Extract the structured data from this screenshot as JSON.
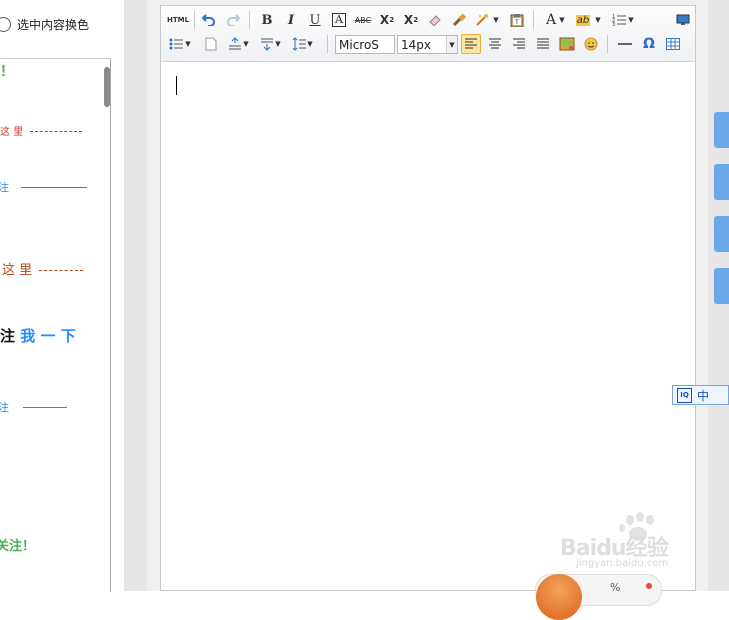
{
  "top_option": {
    "label": "选中内容换色"
  },
  "left_styles": [
    {
      "text": "！",
      "color": "#4caf50"
    },
    {
      "text": "这 里",
      "color": "#c0392b"
    },
    {
      "text": "注",
      "color": "#2a8ce0"
    },
    {
      "text": "这 里",
      "color": "#b5451b"
    },
    {
      "text": "我 一 下",
      "color": "#1e90ff",
      "prefix": "注"
    },
    {
      "text": "注",
      "color": "#2a8ce0"
    },
    {
      "text": "关注！",
      "color": "#4caf50"
    }
  ],
  "toolbar": {
    "html_label": "HTML",
    "font_family": "MicroS",
    "font_size": "14px"
  },
  "ime": {
    "box": "IQ",
    "label": "中"
  },
  "watermark": {
    "brand": "Baidu经验",
    "url": "jingyan.baidu.com"
  },
  "widget": {
    "text": "%"
  },
  "colors": {
    "accent": "#6ba8ea",
    "active": "#fde6a0"
  }
}
